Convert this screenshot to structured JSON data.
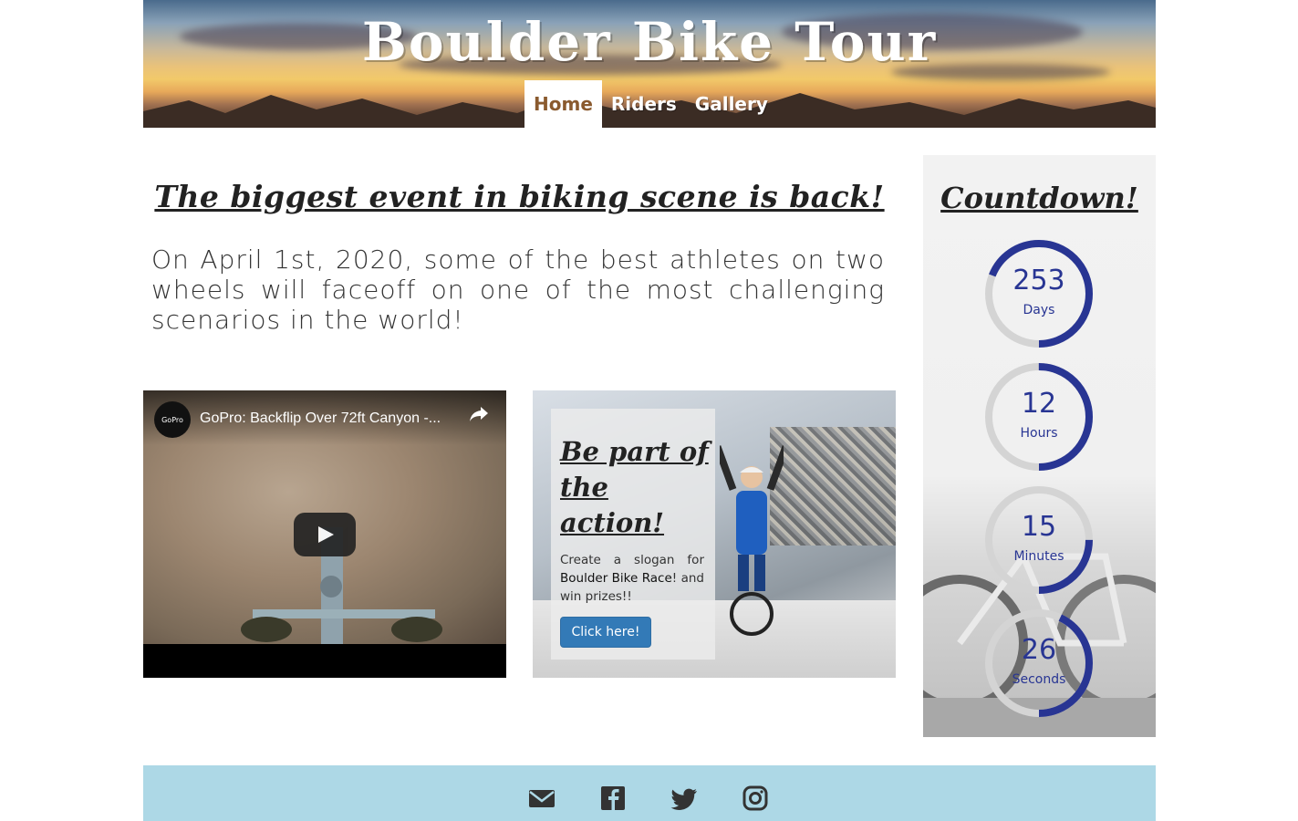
{
  "header": {
    "site_title": "Boulder Bike Tour",
    "nav": [
      {
        "label": "Home",
        "active": true
      },
      {
        "label": "Riders",
        "active": false
      },
      {
        "label": "Gallery",
        "active": false
      }
    ]
  },
  "main": {
    "headline": "The biggest event in biking scene is back!",
    "intro": "On April 1st, 2020, some of the best athletes on two wheels will faceoff on one of the most challenging scenarios in the world!"
  },
  "video": {
    "channel_logo": "GoPro",
    "title": "GoPro: Backflip Over 72ft Canyon -...",
    "icons": {
      "share": "share-icon",
      "play": "play-icon"
    }
  },
  "promo": {
    "title": "Be part of the action!",
    "text_before": "Create a slogan for ",
    "text_strong": "Boulder Bike Race",
    "text_after": "! and win prizes!!",
    "button_label": "Click here!"
  },
  "countdown": {
    "title": "Countdown!",
    "items": [
      {
        "value": "253",
        "label": "Days",
        "progress": 0.69
      },
      {
        "value": "12",
        "label": "Hours",
        "progress": 0.5
      },
      {
        "value": "15",
        "label": "Minutes",
        "progress": 0.25
      },
      {
        "value": "26",
        "label": "Seconds",
        "progress": 0.43
      }
    ],
    "colors": {
      "ring": "#283593",
      "track": "#d4d4d4"
    }
  },
  "footer": {
    "icons": [
      "envelope-icon",
      "facebook-icon",
      "twitter-icon",
      "instagram-icon"
    ],
    "background": "#add8e6"
  }
}
